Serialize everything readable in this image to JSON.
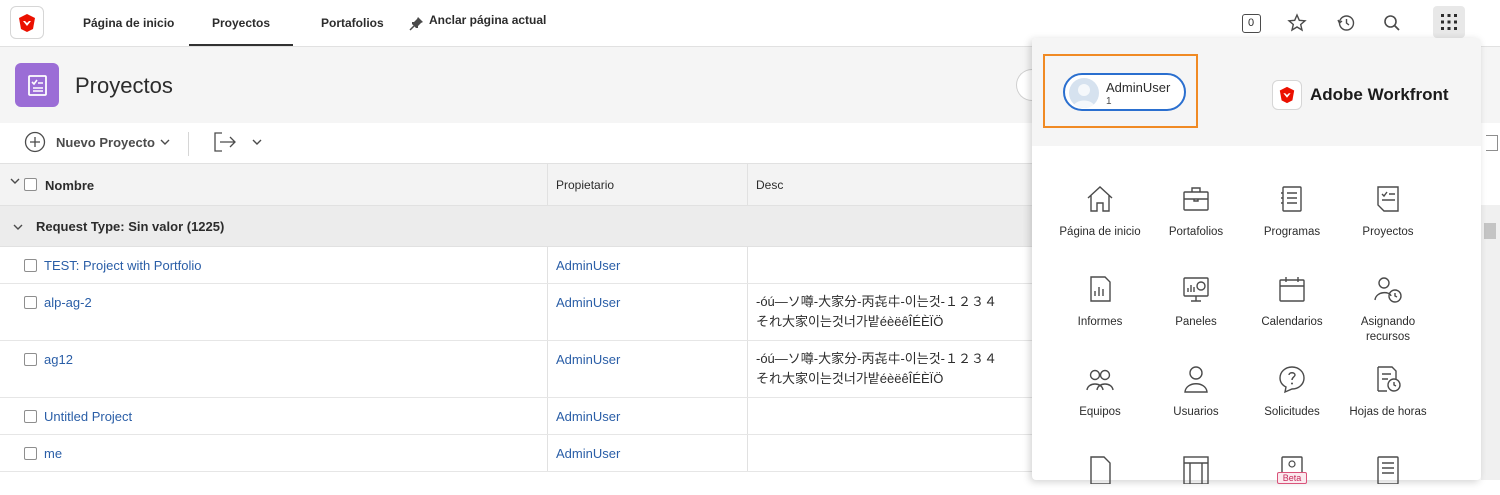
{
  "nav": {
    "tabs": [
      {
        "label": "Página de inicio"
      },
      {
        "label": "Proyectos"
      },
      {
        "label": "Portafolios"
      },
      {
        "label": "Anclar página actual"
      }
    ],
    "counter": "0"
  },
  "header": {
    "title": "Proyectos"
  },
  "toolbar": {
    "new_project": "Nuevo Proyecto"
  },
  "table": {
    "columns": {
      "name": "Nombre",
      "owner": "Propietario",
      "desc": "Desc"
    },
    "group": "Request Type: Sin valor (1225)",
    "rows": [
      {
        "name": "TEST: Project with Portfolio",
        "owner": "AdminUser",
        "desc1": "",
        "desc2": ""
      },
      {
        "name": "alp-ag-2",
        "owner": "AdminUser",
        "desc1": "-óú—ソ噂-大家分-丙㐂㐄-이는것-１２３４",
        "desc2": "それ大家이는것너가밭éèëêÎÉÈÏÖ"
      },
      {
        "name": "ag12",
        "owner": "AdminUser",
        "desc1": "-óú—ソ噂-大家分-丙㐂㐄-이는것-１２３４",
        "desc2": "それ大家이는것너가밭éèëêÎÉÈÏÖ"
      },
      {
        "name": "Untitled Project",
        "owner": "AdminUser",
        "desc1": "",
        "desc2": ""
      },
      {
        "name": "me",
        "owner": "AdminUser",
        "desc1": "",
        "desc2": ""
      }
    ]
  },
  "panel": {
    "user_name": "AdminUser",
    "user_sub": "1",
    "brand": "Adobe Workfront",
    "apps": [
      {
        "label": "Página de inicio",
        "icon": "home-icon"
      },
      {
        "label": "Portafolios",
        "icon": "briefcase-icon"
      },
      {
        "label": "Programas",
        "icon": "program-icon"
      },
      {
        "label": "Proyectos",
        "icon": "project-icon"
      },
      {
        "label": "Informes",
        "icon": "report-icon"
      },
      {
        "label": "Paneles",
        "icon": "dashboard-icon"
      },
      {
        "label": "Calendarios",
        "icon": "calendar-icon"
      },
      {
        "label": "Asignando recursos",
        "icon": "resource-icon"
      },
      {
        "label": "Equipos",
        "icon": "team-icon"
      },
      {
        "label": "Usuarios",
        "icon": "user-icon"
      },
      {
        "label": "Solicitudes",
        "icon": "request-icon"
      },
      {
        "label": "Hojas de horas",
        "icon": "timesheet-icon"
      }
    ],
    "beta_badge": "Beta"
  },
  "colors": {
    "accent": "#2a5ea7",
    "project_icon": "#9b6dd6",
    "highlight": "#f08a24",
    "logo_red": "#eb1000"
  }
}
